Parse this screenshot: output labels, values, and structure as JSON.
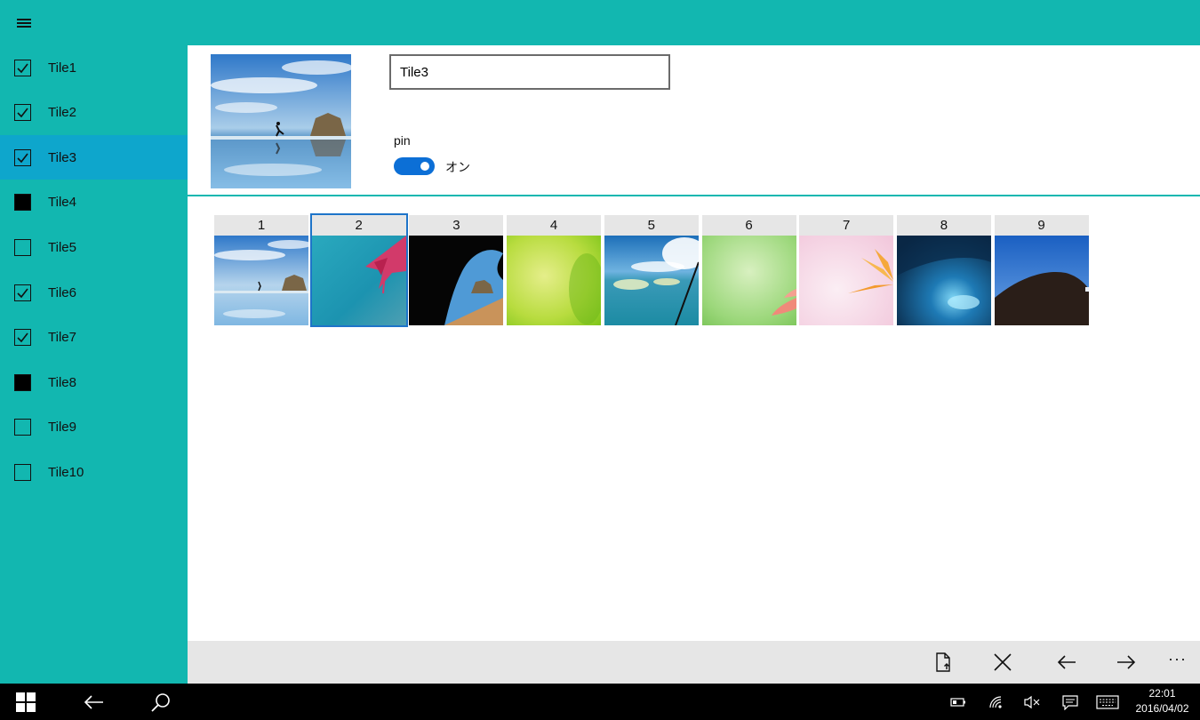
{
  "colors": {
    "accent": "#12b7b0",
    "selected_item": "#0ea6cc",
    "toggle_on": "#0c6fd6",
    "tile_selected_border": "#1e74c9",
    "command_bar": "#e6e6e6",
    "taskbar": "#000000"
  },
  "topbar": {
    "menu_icon": "hamburger-icon"
  },
  "sidebar": {
    "items": [
      {
        "label": "Tile1",
        "state": "checked",
        "selected": false
      },
      {
        "label": "Tile2",
        "state": "checked",
        "selected": false
      },
      {
        "label": "Tile3",
        "state": "checked",
        "selected": true
      },
      {
        "label": "Tile4",
        "state": "filled",
        "selected": false
      },
      {
        "label": "Tile5",
        "state": "unchecked",
        "selected": false
      },
      {
        "label": "Tile6",
        "state": "checked",
        "selected": false
      },
      {
        "label": "Tile7",
        "state": "checked",
        "selected": false
      },
      {
        "label": "Tile8",
        "state": "filled",
        "selected": false
      },
      {
        "label": "Tile9",
        "state": "unchecked",
        "selected": false
      },
      {
        "label": "Tile10",
        "state": "unchecked",
        "selected": false
      }
    ]
  },
  "editor": {
    "name_value": "Tile3",
    "pin_label": "pin",
    "pin_on": true,
    "pin_state_text": "オン"
  },
  "tiles": [
    {
      "number": "1",
      "selected": false,
      "image": "beach-runner"
    },
    {
      "number": "2",
      "selected": true,
      "image": "pink-flower-teal"
    },
    {
      "number": "3",
      "selected": false,
      "image": "cave-beach"
    },
    {
      "number": "4",
      "selected": false,
      "image": "green-yellow"
    },
    {
      "number": "5",
      "selected": false,
      "image": "islands-aerial"
    },
    {
      "number": "6",
      "selected": false,
      "image": "green-leaf"
    },
    {
      "number": "7",
      "selected": false,
      "image": "orange-flower-white"
    },
    {
      "number": "8",
      "selected": false,
      "image": "ice-cave"
    },
    {
      "number": "9",
      "selected": false,
      "image": "hill-blue-sky"
    }
  ],
  "command_bar": {
    "buttons": [
      "save-file-icon",
      "close-icon",
      "back-arrow-icon",
      "forward-arrow-icon"
    ],
    "more_label": "···"
  },
  "taskbar": {
    "time": "22:01",
    "date": "2016/04/02",
    "icons": [
      "windows-start-icon",
      "back-arrow-icon",
      "search-icon",
      "battery-icon",
      "wifi-icon",
      "volume-muted-icon",
      "action-center-icon",
      "keyboard-icon"
    ]
  }
}
